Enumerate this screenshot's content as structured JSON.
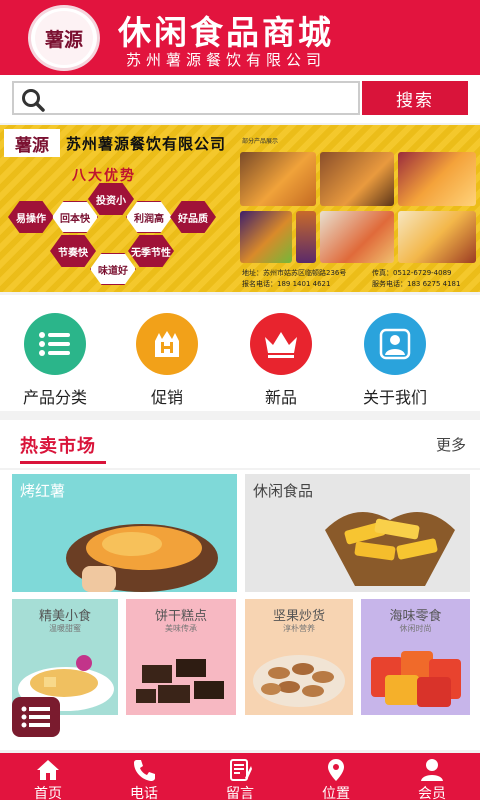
{
  "header": {
    "logo_text": "薯源",
    "title": "休闲食品商城",
    "subtitle": "苏州薯源餐饮有限公司"
  },
  "search": {
    "placeholder": "",
    "value": "",
    "button_label": "搜索",
    "icon": "search-icon"
  },
  "banner": {
    "logo_text": "薯源",
    "company": "苏州薯源餐饮有限公司",
    "advantages_title": "八大优势",
    "advantages": [
      "投资小",
      "易操作",
      "回本快",
      "利润高",
      "好品质",
      "节奏快",
      "无季节性",
      "味道好"
    ],
    "caption": "部分产品展示",
    "address": "地址：苏州市姑苏区临顿路236号",
    "fax": "传真：0512-6729-4089",
    "signup_phone": "报名电话：189 1401 4621",
    "service_phone": "服务电话：183 6275 4181"
  },
  "categories": [
    {
      "label": "产品分类",
      "icon": "list-icon",
      "color": "#2bb58a"
    },
    {
      "label": "促销",
      "icon": "promo-icon",
      "color": "#f2a119"
    },
    {
      "label": "新品",
      "icon": "crown-icon",
      "color": "#e8242e"
    },
    {
      "label": "关于我们",
      "icon": "person-icon",
      "color": "#2aa3dc"
    }
  ],
  "hot_market": {
    "title": "热卖市场",
    "more": "更多"
  },
  "tiles": {
    "large": [
      {
        "title": "烤红薯",
        "bg": "#7fd9d8"
      },
      {
        "title": "休闲食品",
        "bg": "#e6e6e6"
      }
    ],
    "small": [
      {
        "title": "精美小食",
        "subtitle": "温暖甜蜜",
        "bg": "#a6ded6"
      },
      {
        "title": "饼干糕点",
        "subtitle": "美味传承",
        "bg": "#f7b8c2"
      },
      {
        "title": "坚果炒货",
        "subtitle": "淳朴营养",
        "bg": "#f7d4b2"
      },
      {
        "title": "海味零食",
        "subtitle": "休闲时尚",
        "bg": "#c7b5ea"
      }
    ]
  },
  "nav": [
    {
      "label": "首页",
      "icon": "home-icon"
    },
    {
      "label": "电话",
      "icon": "phone-icon"
    },
    {
      "label": "留言",
      "icon": "message-icon"
    },
    {
      "label": "位置",
      "icon": "location-icon"
    },
    {
      "label": "会员",
      "icon": "member-icon"
    }
  ],
  "colors": {
    "brand": "#e2143e",
    "banner": "#f3c31a"
  }
}
